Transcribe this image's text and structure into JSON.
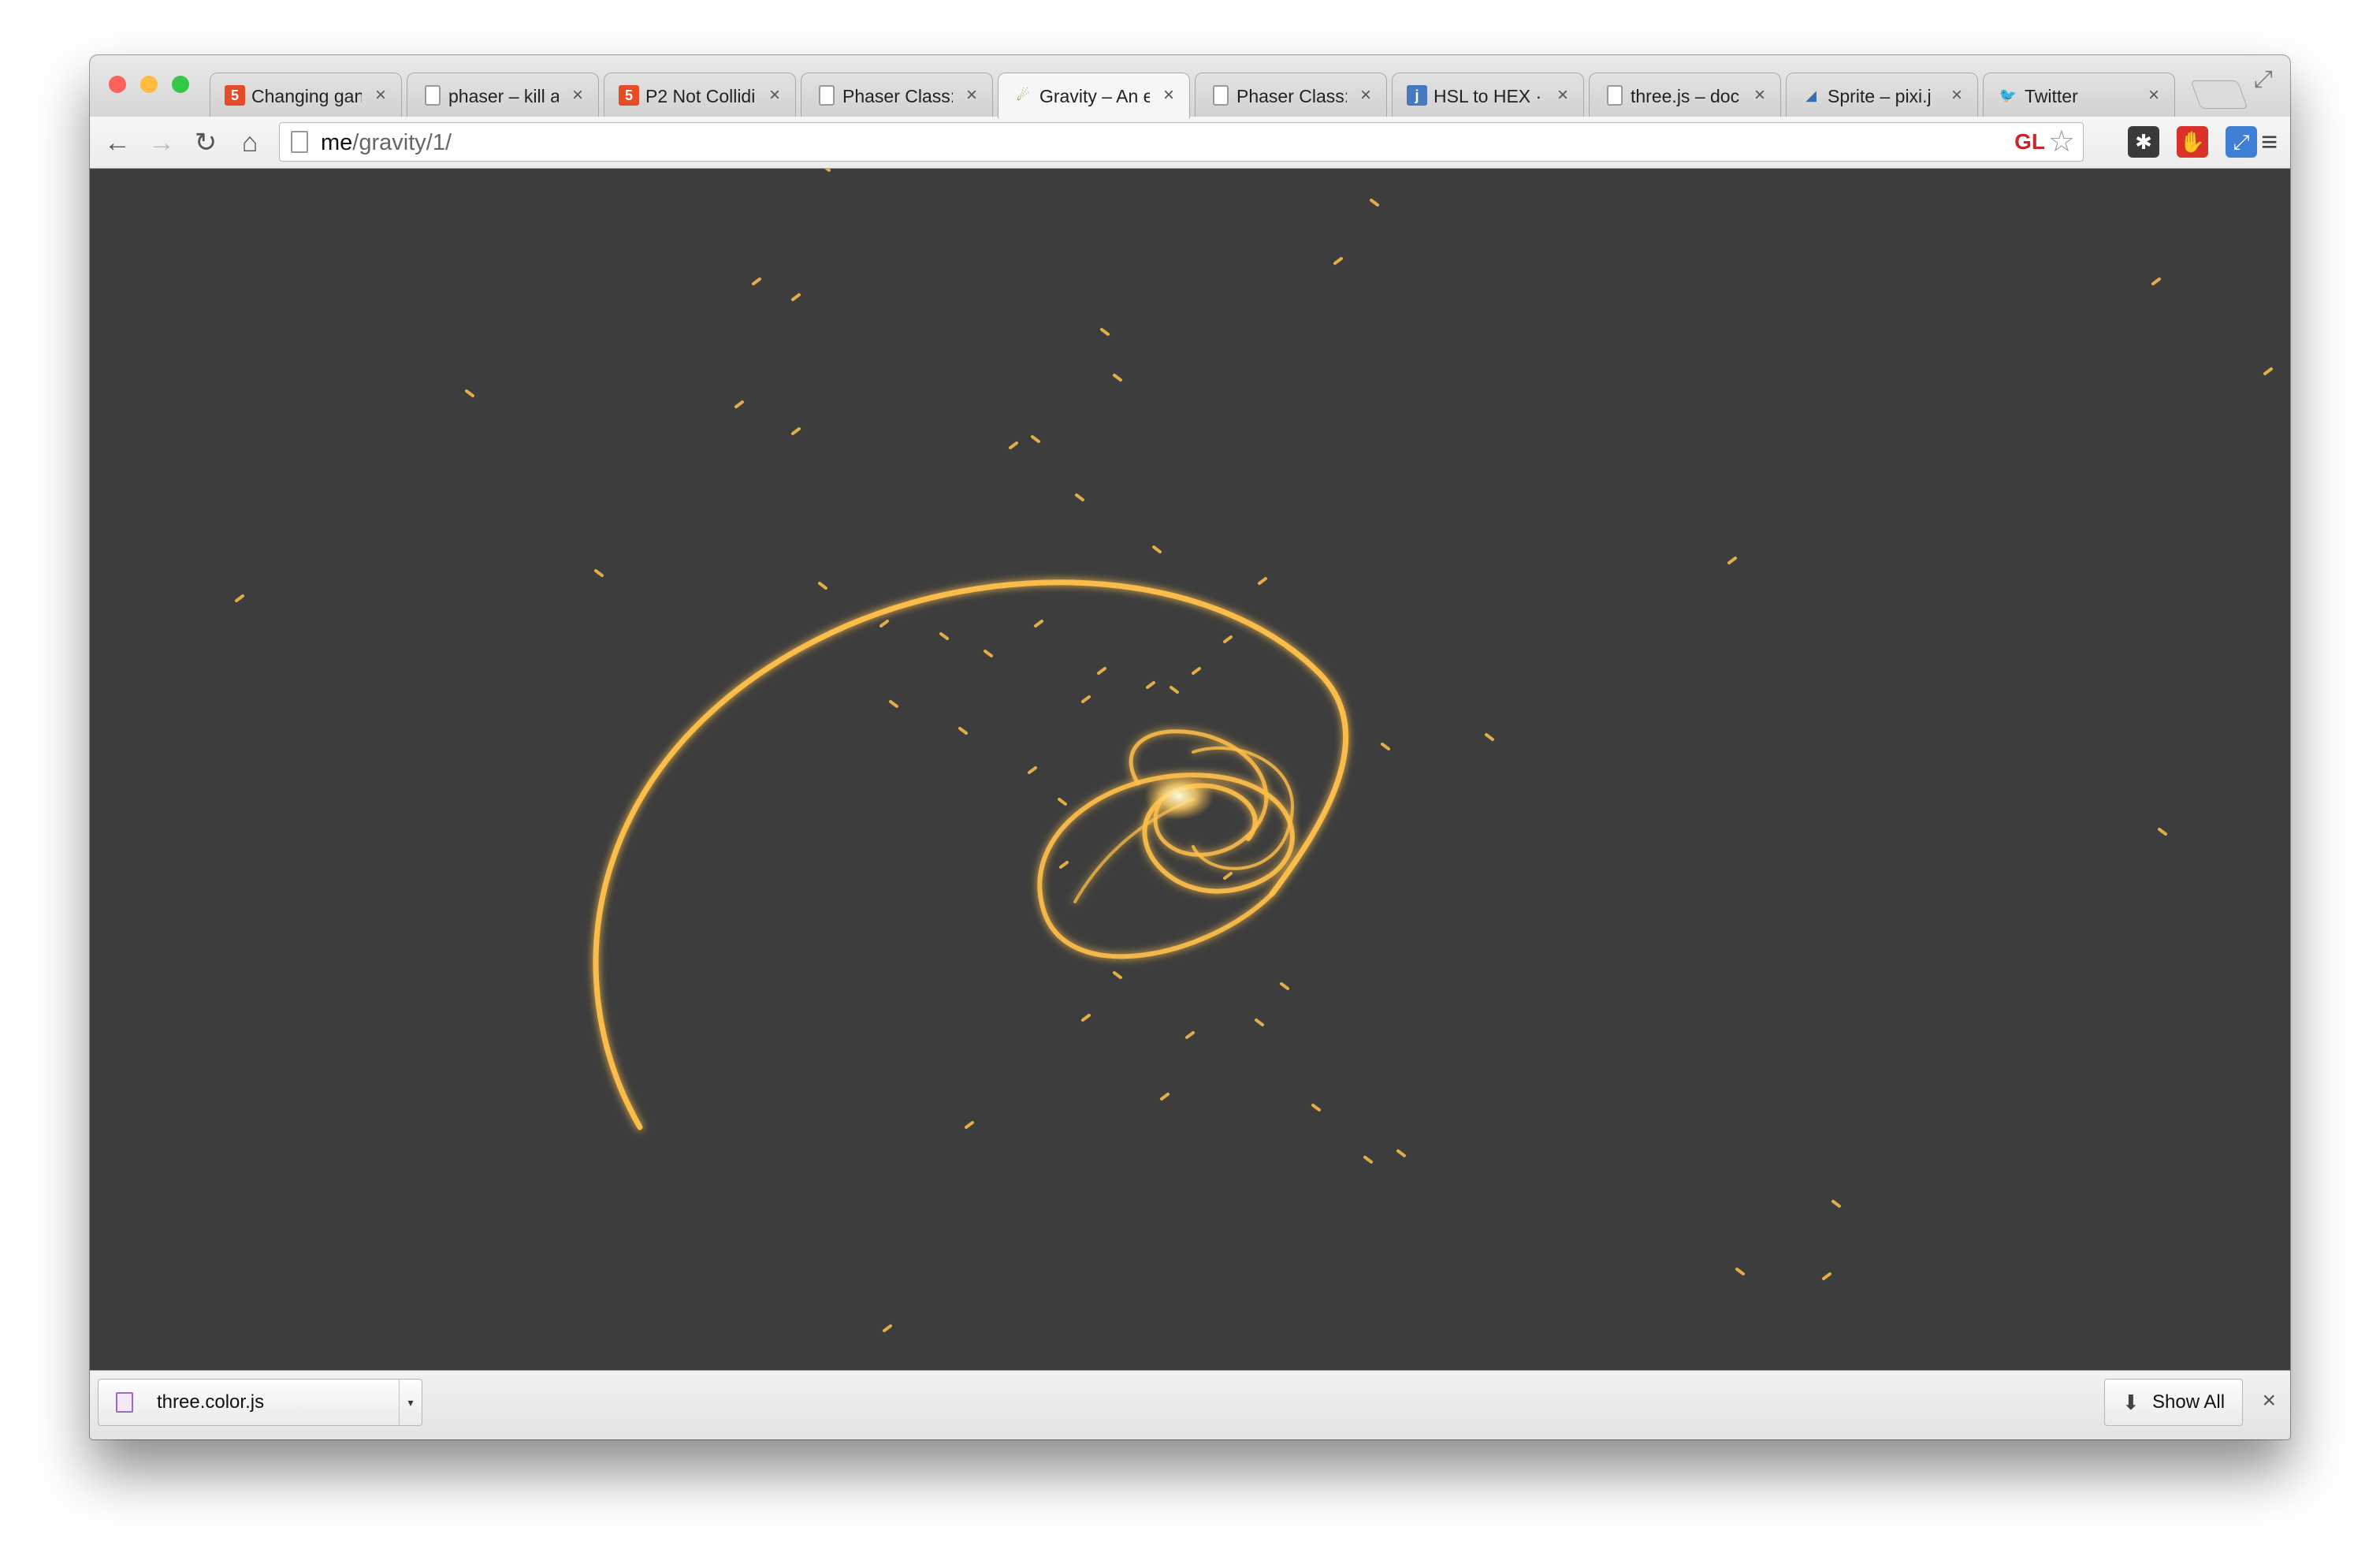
{
  "window": {
    "traffic_lights": [
      {
        "name": "close",
        "color": "#fc615d"
      },
      {
        "name": "minimize",
        "color": "#fdbc40"
      },
      {
        "name": "zoom",
        "color": "#34c84a"
      }
    ]
  },
  "tabs": [
    {
      "title": "Changing gan",
      "icon": "html5-icon",
      "icon_color": "#e44d26",
      "active": false
    },
    {
      "title": "phaser – kill a",
      "icon": "document-icon",
      "icon_color": "#888888",
      "active": false
    },
    {
      "title": "P2 Not Collidi",
      "icon": "html5-icon",
      "icon_color": "#e44d26",
      "active": false
    },
    {
      "title": "Phaser Class:",
      "icon": "document-icon",
      "icon_color": "#888888",
      "active": false
    },
    {
      "title": "Gravity – An e",
      "icon": "gravity-icon",
      "icon_color": "#8a6d2a",
      "active": true
    },
    {
      "title": "Phaser Class:",
      "icon": "document-icon",
      "icon_color": "#888888",
      "active": false
    },
    {
      "title": "HSL to HEX · j",
      "icon": "jsfiddle-icon",
      "icon_color": "#4679bd",
      "active": false
    },
    {
      "title": "three.js – doc",
      "icon": "document-icon",
      "icon_color": "#888888",
      "active": false
    },
    {
      "title": "Sprite – pixi.j",
      "icon": "pixi-icon",
      "icon_color": "#3b6ea8",
      "active": false
    },
    {
      "title": "Twitter",
      "icon": "twitter-icon",
      "icon_color": "#55acee",
      "active": false
    }
  ],
  "toolbar": {
    "back": "←",
    "forward": "→",
    "reload": "↻",
    "home": "⌂",
    "url_host": "me",
    "url_path": "/gravity/1/",
    "gl_badge": "GL",
    "bookmark_star": "☆",
    "menu": "≡"
  },
  "extensions": [
    {
      "name": "asterisk-extension-icon",
      "glyph": "✱",
      "bg": "#3a3a3a"
    },
    {
      "name": "stop-hand-extension-icon",
      "glyph": "✋",
      "bg": "#d9322b"
    },
    {
      "name": "blue-extension-icon",
      "glyph": "⤢",
      "bg": "#3f7fd6"
    }
  ],
  "canvas": {
    "background": "#3d3d3d",
    "particle_color": "#ffc04a",
    "glow_color": "#fff2b0"
  },
  "downloads": {
    "file_name": "three.color.js",
    "dropdown": "▾",
    "show_all_icon": "⬇",
    "show_all_label": "Show All",
    "close": "×"
  },
  "tab_close_glyph": "×",
  "fullscreen_glyph": "⤢"
}
